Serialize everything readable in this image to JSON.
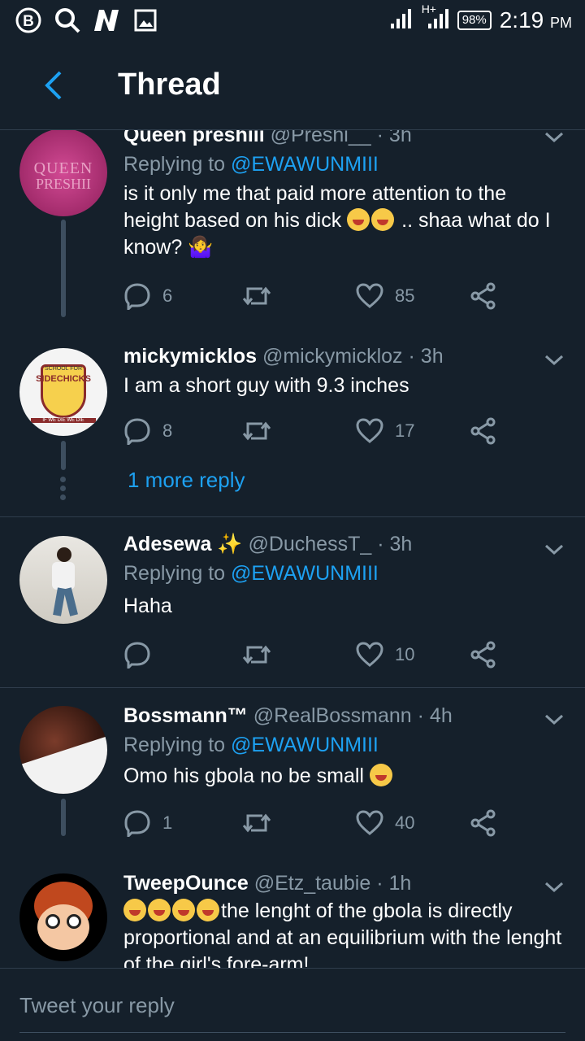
{
  "status_bar": {
    "battery": "98%",
    "time": "2:19",
    "ampm": "PM",
    "network": "H+"
  },
  "header": {
    "title": "Thread"
  },
  "tweets": [
    {
      "name": "Queen preshiii",
      "handle": "@Preshi__",
      "time": "· 3h",
      "replying_label": "Replying to",
      "replying_to": "@EWAWUNMIII",
      "text_line1": "is it only me that paid more attention to the",
      "text_line2": "height based on his dick",
      "text_line2b": " .. shaa what do I",
      "text_line3": "know? 🤷‍♀",
      "avatar_text_1": "QUEEN",
      "avatar_text_2": "PRESHII",
      "replies": "6",
      "likes": "85"
    },
    {
      "name": "mickymicklos",
      "handle": "@mickymickloz",
      "time": "· 3h",
      "text": "I am a short guy with 9.3 inches",
      "avatar_text_1": "SCHOOL FOR",
      "avatar_text_2": "SIDECHICKS",
      "avatar_text_3": "IF WE DIE WE DIE",
      "replies": "8",
      "likes": "17"
    },
    {
      "name": "Adesewa",
      "handle": "@DuchessT_",
      "time": "· 3h",
      "replying_label": "Replying to",
      "replying_to": "@EWAWUNMIII",
      "text": "Haha",
      "replies": "",
      "likes": "10"
    },
    {
      "name": "Bossmann™",
      "handle": "@RealBossmann",
      "time": "· 4h",
      "replying_label": "Replying to",
      "replying_to": "@EWAWUNMIII",
      "text": "Omo his gbola no be small",
      "replies": "1",
      "likes": "40"
    },
    {
      "name": "TweepOunce",
      "handle": "@Etz_taubie",
      "time": "· 1h",
      "text_line1": "the lenght of the gbola is directly",
      "text_line2": "proportional and at an equilibrium with the lenght",
      "text_line3": "of the girl's fore-arm!"
    }
  ],
  "more_reply": "1 more reply",
  "compose": {
    "placeholder": "Tweet your reply"
  },
  "colors": {
    "background": "#15202b",
    "accent": "#1da1f2",
    "muted": "#8899a6"
  }
}
